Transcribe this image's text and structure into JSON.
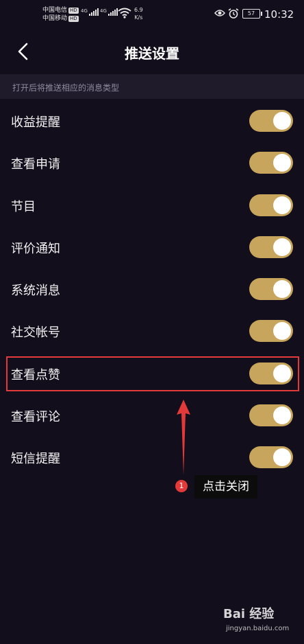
{
  "status_bar": {
    "carrier1": "中国电信",
    "carrier2": "中国移动",
    "hd": "HD",
    "net1": "4G",
    "net2": "4G",
    "speed_value": "6.9",
    "speed_unit": "K/s",
    "battery": "57",
    "time": "10:32"
  },
  "header": {
    "title": "推送设置"
  },
  "hint": "打开后将推送相应的消息类型",
  "settings": [
    {
      "label": "收益提醒",
      "enabled": true
    },
    {
      "label": "查看申请",
      "enabled": true
    },
    {
      "label": "节目",
      "enabled": true
    },
    {
      "label": "评价通知",
      "enabled": true
    },
    {
      "label": "系统消息",
      "enabled": true
    },
    {
      "label": "社交帐号",
      "enabled": true
    },
    {
      "label": "查看点赞",
      "enabled": true
    },
    {
      "label": "查看评论",
      "enabled": true
    },
    {
      "label": "短信提醒",
      "enabled": true
    }
  ],
  "annotation": {
    "step": "1",
    "text": "点击关闭"
  },
  "watermark": {
    "brand": "Bai 经验",
    "url": "jingyan.baidu.com"
  },
  "colors": {
    "background": "#120e1c",
    "toggle_on": "#c8a55c",
    "highlight": "#e23a3a"
  }
}
